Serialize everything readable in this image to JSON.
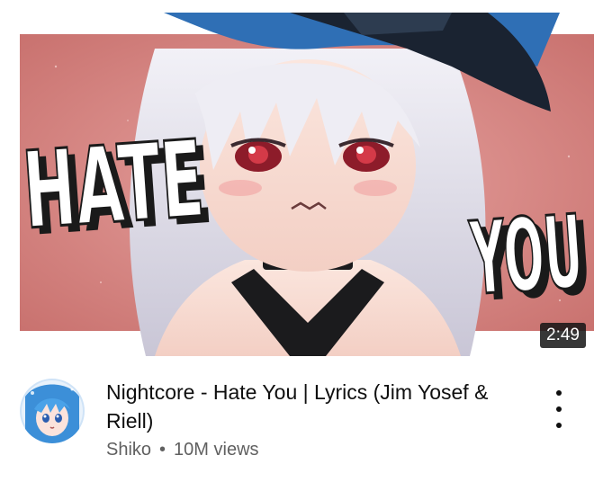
{
  "video": {
    "thumbnail_text_left": "HATE",
    "thumbnail_text_right": "YOU",
    "duration": "2:49",
    "title": "Nightcore - Hate You | Lyrics (Jim Yosef & Riell)",
    "channel": "Shiko",
    "separator": "•",
    "views": "10M views",
    "avatar_icon": "channel-avatar-anime",
    "more_icon": "more-vert-icon"
  },
  "colors": {
    "thumbnail_bg": "#d98a86",
    "hat": "#1c2a3a",
    "hat_brim": "#2f6fb5",
    "hair": "#e8e6ef",
    "text": "#0f0f0f",
    "meta_text": "#606060"
  }
}
